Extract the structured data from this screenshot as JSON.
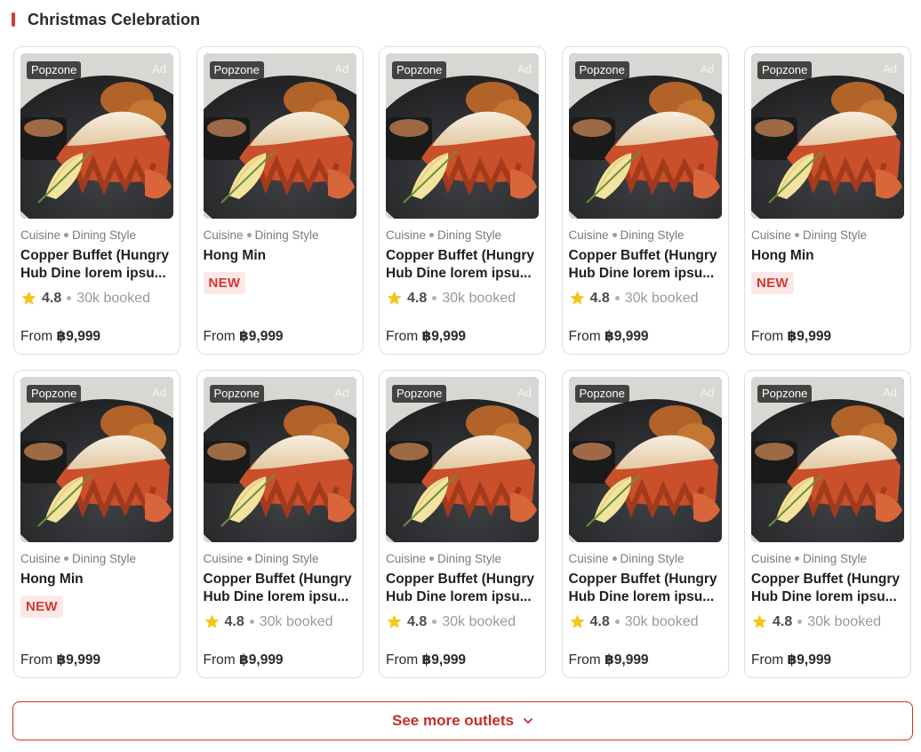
{
  "section": {
    "title": "Christmas Celebration"
  },
  "colors": {
    "accent": "#d13a3a",
    "new_badge_bg": "#fde8e8",
    "new_badge_text": "#d0392f",
    "star": "#f5c518"
  },
  "cards": [
    {
      "variant": "rated",
      "brand": "Popzone",
      "ad": "Ad",
      "cuisine": "Cuisine",
      "style": "Dining Style",
      "name_lines": [
        "Copper Buffet (Hungry",
        "Hub Dine lorem ipsu..."
      ],
      "rating": "4.8",
      "booked": "30k booked",
      "badge": "",
      "price_prefix": "From",
      "price": "฿9,999"
    },
    {
      "variant": "new",
      "brand": "Popzone",
      "ad": "Ad",
      "cuisine": "Cuisine",
      "style": "Dining Style",
      "name_lines": [
        "Hong Min",
        ""
      ],
      "rating": "",
      "booked": "",
      "badge": "NEW",
      "price_prefix": "From",
      "price": "฿9,999"
    },
    {
      "variant": "rated",
      "brand": "Popzone",
      "ad": "Ad",
      "cuisine": "Cuisine",
      "style": "Dining Style",
      "name_lines": [
        "Copper Buffet (Hungry",
        "Hub Dine lorem ipsu..."
      ],
      "rating": "4.8",
      "booked": "30k booked",
      "badge": "",
      "price_prefix": "From",
      "price": "฿9,999"
    },
    {
      "variant": "rated",
      "brand": "Popzone",
      "ad": "Ad",
      "cuisine": "Cuisine",
      "style": "Dining Style",
      "name_lines": [
        "Copper Buffet (Hungry",
        "Hub Dine lorem ipsu..."
      ],
      "rating": "4.8",
      "booked": "30k booked",
      "badge": "",
      "price_prefix": "From",
      "price": "฿9,999"
    },
    {
      "variant": "new",
      "brand": "Popzone",
      "ad": "Ad",
      "cuisine": "Cuisine",
      "style": "Dining Style",
      "name_lines": [
        "Hong Min",
        ""
      ],
      "rating": "",
      "booked": "",
      "badge": "NEW",
      "price_prefix": "From",
      "price": "฿9,999"
    },
    {
      "variant": "new",
      "brand": "Popzone",
      "ad": "Ad",
      "cuisine": "Cuisine",
      "style": "Dining Style",
      "name_lines": [
        "Hong Min",
        ""
      ],
      "rating": "",
      "booked": "",
      "badge": "NEW",
      "price_prefix": "From",
      "price": "฿9,999"
    },
    {
      "variant": "rated",
      "brand": "Popzone",
      "ad": "Ad",
      "cuisine": "Cuisine",
      "style": "Dining Style",
      "name_lines": [
        "Copper Buffet (Hungry",
        "Hub Dine lorem ipsu..."
      ],
      "rating": "4.8",
      "booked": "30k booked",
      "badge": "",
      "price_prefix": "From",
      "price": "฿9,999"
    },
    {
      "variant": "rated",
      "brand": "Popzone",
      "ad": "Ad",
      "cuisine": "Cuisine",
      "style": "Dining Style",
      "name_lines": [
        "Copper Buffet (Hungry",
        "Hub Dine lorem ipsu..."
      ],
      "rating": "4.8",
      "booked": "30k booked",
      "badge": "",
      "price_prefix": "From",
      "price": "฿9,999"
    },
    {
      "variant": "rated",
      "brand": "Popzone",
      "ad": "Ad",
      "cuisine": "Cuisine",
      "style": "Dining Style",
      "name_lines": [
        "Copper Buffet (Hungry",
        "Hub Dine lorem ipsu..."
      ],
      "rating": "4.8",
      "booked": "30k booked",
      "badge": "",
      "price_prefix": "From",
      "price": "฿9,999"
    },
    {
      "variant": "rated",
      "brand": "Popzone",
      "ad": "Ad",
      "cuisine": "Cuisine",
      "style": "Dining Style",
      "name_lines": [
        "Copper Buffet (Hungry",
        "Hub Dine lorem ipsu..."
      ],
      "rating": "4.8",
      "booked": "30k booked",
      "badge": "",
      "price_prefix": "From",
      "price": "฿9,999"
    }
  ],
  "more_button": {
    "label": "See more outlets",
    "icon": "chevron-down-icon"
  }
}
